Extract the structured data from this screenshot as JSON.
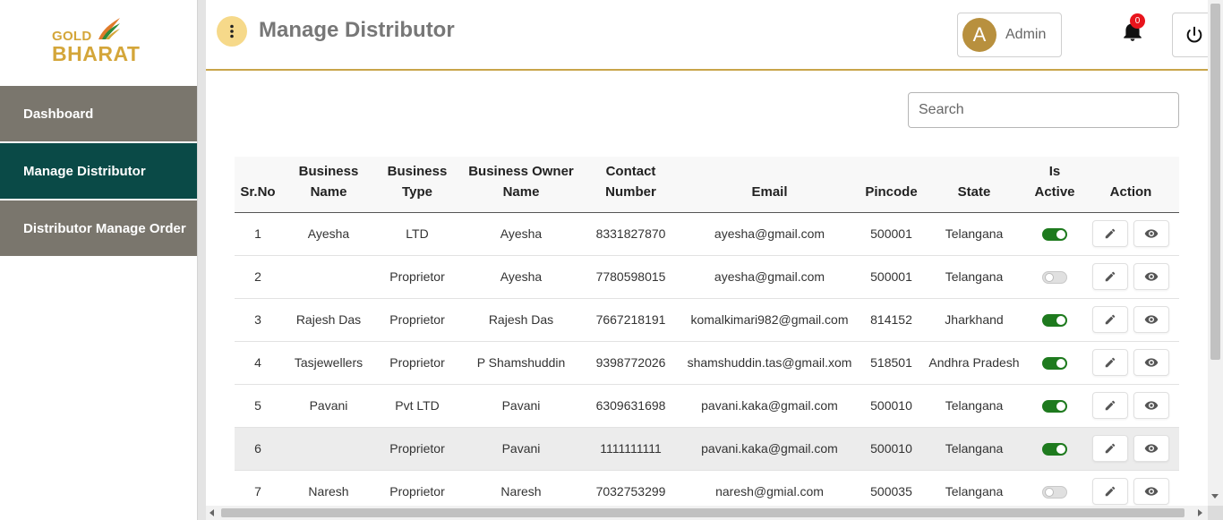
{
  "brand": {
    "line1": "GOLD",
    "line2": "BHARAT",
    "color": "#d4a63a"
  },
  "sidebar": {
    "items": [
      {
        "label": "Dashboard",
        "active": false
      },
      {
        "label": "Manage Distributor",
        "active": true
      },
      {
        "label": "Distributor Manage Order",
        "active": false
      }
    ],
    "active_color": "#0a4a47",
    "inactive_color": "#7a766d"
  },
  "header": {
    "title": "Manage Distributor",
    "user": {
      "initial": "A",
      "name": "Admin"
    },
    "notifications_count": "0",
    "icons": {
      "menu": "more-vertical-icon",
      "bell": "bell-icon",
      "power": "power-icon"
    }
  },
  "search": {
    "placeholder": "Search",
    "value": ""
  },
  "table": {
    "columns": [
      "Sr.No",
      "Business Name",
      "Business Type",
      "Business Owner Name",
      "Contact Number",
      "Email",
      "Pincode",
      "State",
      "Is Active",
      "Action"
    ],
    "rows": [
      {
        "sr": "1",
        "business_name": "Ayesha",
        "business_type": "LTD",
        "owner": "Ayesha",
        "contact": "8331827870",
        "email": "ayesha@gmail.com",
        "pincode": "500001",
        "state": "Telangana",
        "active": true
      },
      {
        "sr": "2",
        "business_name": "",
        "business_type": "Proprietor",
        "owner": "Ayesha",
        "contact": "7780598015",
        "email": "ayesha@gmail.com",
        "pincode": "500001",
        "state": "Telangana",
        "active": false
      },
      {
        "sr": "3",
        "business_name": "Rajesh Das",
        "business_type": "Proprietor",
        "owner": "Rajesh Das",
        "contact": "7667218191",
        "email": "komalkimari982@gmail.com",
        "pincode": "814152",
        "state": "Jharkhand",
        "active": true
      },
      {
        "sr": "4",
        "business_name": "Tasjewellers",
        "business_type": "Proprietor",
        "owner": "P Shamshuddin",
        "contact": "9398772026",
        "email": "shamshuddin.tas@gmail.xom",
        "pincode": "518501",
        "state": "Andhra Pradesh",
        "active": true
      },
      {
        "sr": "5",
        "business_name": "Pavani",
        "business_type": "Pvt LTD",
        "owner": "Pavani",
        "contact": "6309631698",
        "email": "pavani.kaka@gmail.com",
        "pincode": "500010",
        "state": "Telangana",
        "active": true
      },
      {
        "sr": "6",
        "business_name": "",
        "business_type": "Proprietor",
        "owner": "Pavani",
        "contact": "1111111111",
        "email": "pavani.kaka@gmail.com",
        "pincode": "500010",
        "state": "Telangana",
        "active": true
      },
      {
        "sr": "7",
        "business_name": "Naresh",
        "business_type": "Proprietor",
        "owner": "Naresh",
        "contact": "7032753299",
        "email": "naresh@gmial.com",
        "pincode": "500035",
        "state": "Telangana",
        "active": false
      }
    ],
    "shaded_row": 6,
    "action_icons": [
      "edit-icon",
      "view-icon"
    ],
    "toggle_on_color": "#1e7a1e"
  }
}
